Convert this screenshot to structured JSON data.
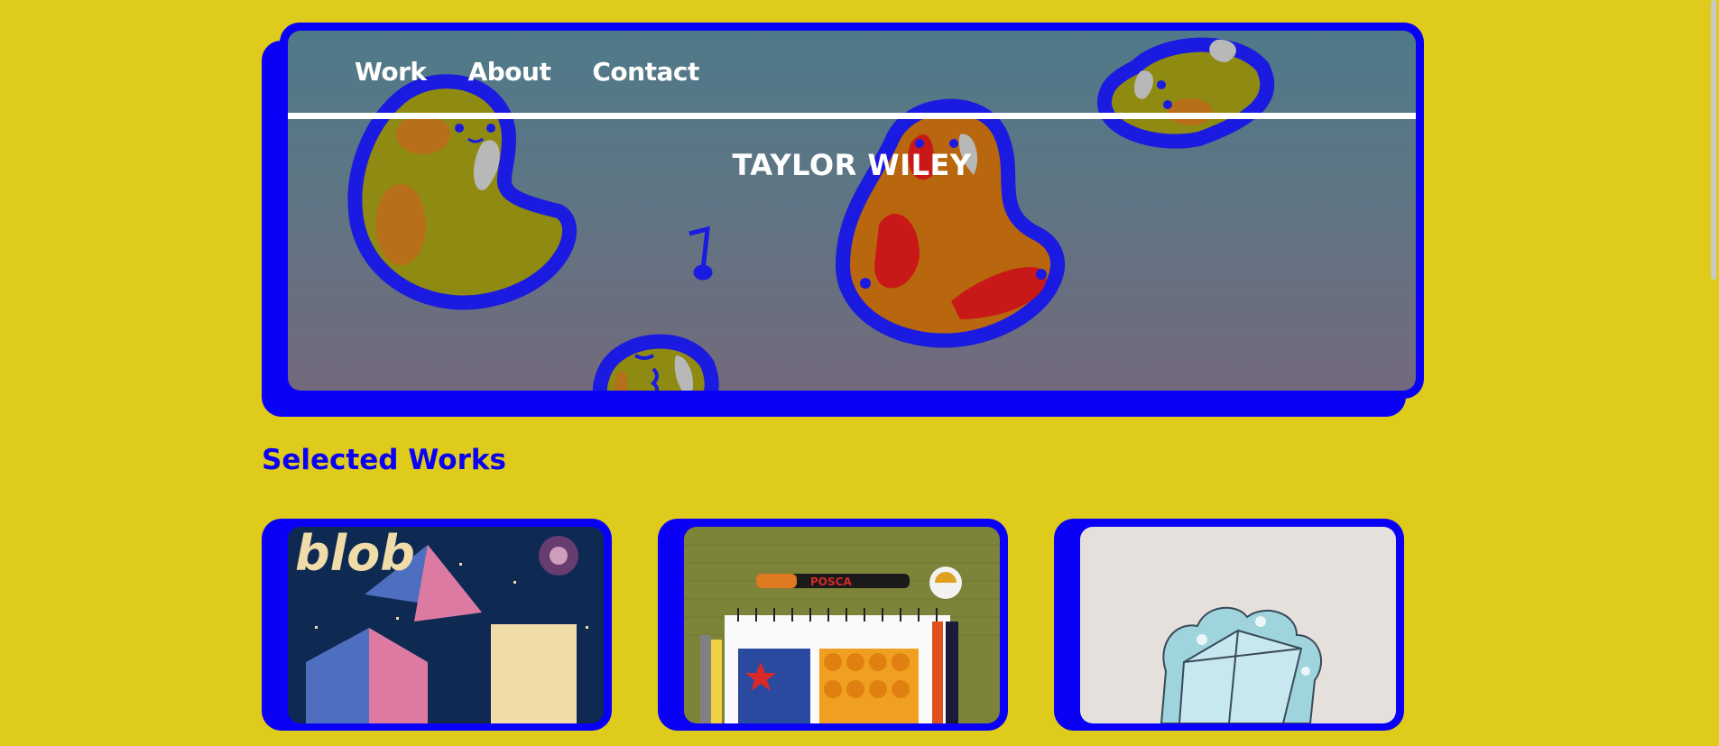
{
  "nav": {
    "items": [
      {
        "label": "Work"
      },
      {
        "label": "About"
      },
      {
        "label": "Contact"
      }
    ]
  },
  "hero": {
    "title": "TAYLOR WILEY",
    "image_icon": "jellybean-pixel-art-image"
  },
  "selected_works": {
    "heading": "Selected Works",
    "cards": [
      {
        "thumb_text": "blob",
        "image_icon": "blob-pixel-art-image"
      },
      {
        "brand_text": "POSCA",
        "image_icon": "posca-markers-sketchbook-image"
      },
      {
        "image_icon": "ink-sketch-image"
      }
    ]
  },
  "colors": {
    "background": "#dfcb1c",
    "accent_blue": "#0a00f5",
    "text_light": "#ffffff"
  }
}
